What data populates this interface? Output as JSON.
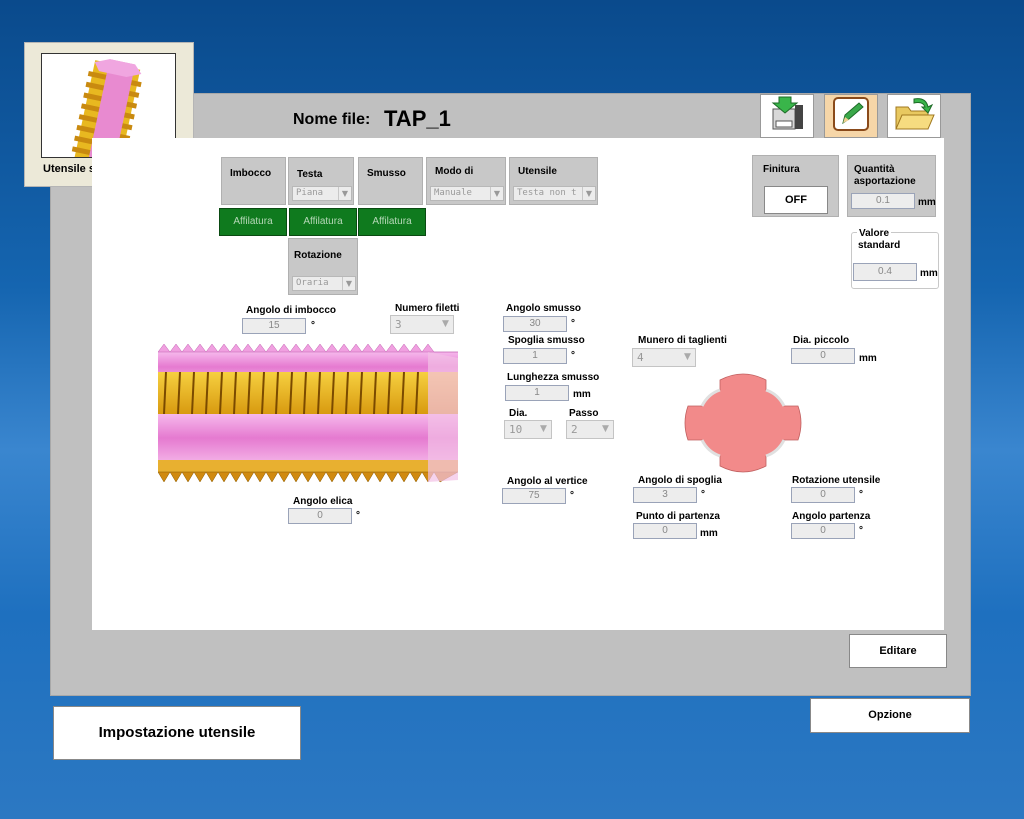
{
  "header": {
    "nome_file_label": "Nome file:",
    "nome_file_value": "TAP_1"
  },
  "tool_card": {
    "label": "Utensile selezionato"
  },
  "toolbar": {
    "icons": [
      "save-file-icon",
      "edit-pencil-icon",
      "open-folder-icon"
    ]
  },
  "groups": {
    "imbocco": {
      "label": "Imbocco",
      "button": "Affilatura"
    },
    "testa": {
      "label": "Testa",
      "value": "Piana",
      "button": "Affilatura"
    },
    "smusso": {
      "label": "Smusso",
      "button": "Affilatura"
    },
    "modo": {
      "label": "Modo di",
      "value": "Manuale"
    },
    "utensile": {
      "label": "Utensile",
      "value": "Testa non t"
    },
    "rotazione": {
      "label": "Rotazione",
      "value": "Oraria"
    }
  },
  "finitura": {
    "label": "Finitura",
    "value": "OFF"
  },
  "quantita": {
    "label_line1": "Quantità",
    "label_line2": "asportazione",
    "value": "0.1",
    "unit": "mm"
  },
  "valore_standard": {
    "label_line1": "Valore",
    "label_line2": "standard",
    "value": "0.4",
    "unit": "mm"
  },
  "params": {
    "angolo_imbocco": {
      "label": "Angolo di imbocco",
      "value": "15",
      "unit": "°"
    },
    "numero_filetti": {
      "label": "Numero filetti",
      "value": "3"
    },
    "angolo_elica": {
      "label": "Angolo elica",
      "value": "0",
      "unit": "°"
    },
    "angolo_smusso": {
      "label": "Angolo smusso",
      "value": "30",
      "unit": "°"
    },
    "spoglia_smusso": {
      "label": "Spoglia smusso",
      "value": "1",
      "unit": "°"
    },
    "lunghezza_smusso": {
      "label": "Lunghezza smusso",
      "value": "1",
      "unit": "mm"
    },
    "dia": {
      "label": "Dia.",
      "value": "10"
    },
    "passo": {
      "label": "Passo",
      "value": "2"
    },
    "angolo_vertice": {
      "label": "Angolo al vertice",
      "value": "75",
      "unit": "°"
    },
    "numero_taglienti": {
      "label": "Munero di taglienti",
      "value": "4"
    },
    "dia_piccolo": {
      "label": "Dia. piccolo",
      "value": "0",
      "unit": "mm"
    },
    "angolo_spoglia": {
      "label": "Angolo di spoglia",
      "value": "3",
      "unit": "°"
    },
    "punto_partenza": {
      "label": "Punto di partenza",
      "value": "0",
      "unit": "mm"
    },
    "rotazione_utensile": {
      "label": "Rotazione utensile",
      "value": "0",
      "unit": "°"
    },
    "angolo_partenza": {
      "label": "Angolo partenza",
      "value": "0",
      "unit": "°"
    }
  },
  "buttons": {
    "editare": "Editare",
    "opzione": "Opzione",
    "impostazione": "Impostazione utensile"
  },
  "colors": {
    "green_button": "#0f7a1e",
    "tap_pink": "#e88ad0",
    "tap_gold": "#e8b820",
    "cross_section": "#f28a8a"
  }
}
